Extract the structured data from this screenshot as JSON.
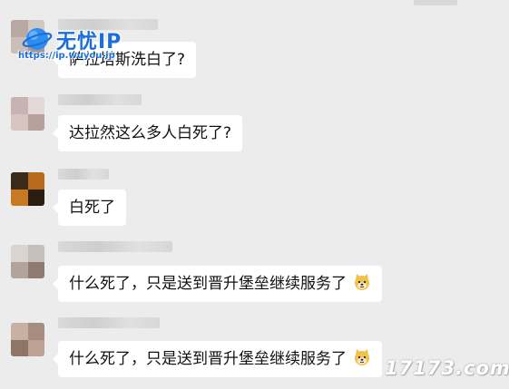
{
  "logo": {
    "brand": "无忧IP",
    "url": "https://ip.wuyou.ip"
  },
  "messages": [
    {
      "text": "萨拉塔斯洗白了?",
      "emoji": ""
    },
    {
      "text": "达拉然这么多人白死了?",
      "emoji": ""
    },
    {
      "text": "白死了",
      "emoji": ""
    },
    {
      "text": "什么死了，只是送到晋升堡垒继续服务了",
      "emoji": "doge-face-icon"
    },
    {
      "text": "什么死了，只是送到晋升堡垒继续服务了",
      "emoji": "doge-face-icon"
    }
  ],
  "watermark": "17173.com",
  "colors": {
    "background": "#ececec",
    "bubble": "#ffffff",
    "logo_blue": "#1b6fd8"
  }
}
